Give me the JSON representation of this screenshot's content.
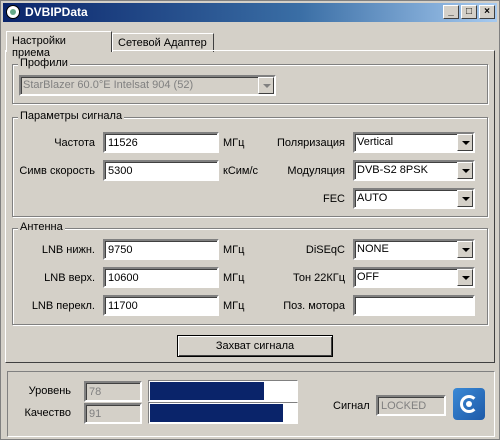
{
  "window": {
    "title": "DVBIPData",
    "min": "_",
    "max": "□",
    "close": "×"
  },
  "tabs": [
    {
      "label": "Настройки приема"
    },
    {
      "label": "Сетевой Адаптер"
    }
  ],
  "profiles": {
    "group_label": "Профили",
    "selected": "StarBlazer 60.0°E Intelsat 904 (52)"
  },
  "signal_params": {
    "group_label": "Параметры сигнала",
    "freq_label": "Частота",
    "freq_value": "11526",
    "freq_unit": "МГц",
    "sr_label": "Симв скорость",
    "sr_value": "5300",
    "sr_unit": "кСим/с",
    "pol_label": "Поляризация",
    "pol_value": "Vertical",
    "mod_label": "Модуляция",
    "mod_value": "DVB-S2 8PSK",
    "fec_label": "FEC",
    "fec_value": "AUTO"
  },
  "antenna": {
    "group_label": "Антенна",
    "lnb_low_label": "LNB нижн.",
    "lnb_low_value": "9750",
    "lnb_low_unit": "МГц",
    "lnb_high_label": "LNB верх.",
    "lnb_high_value": "10600",
    "lnb_high_unit": "МГц",
    "lnb_switch_label": "LNB перекл.",
    "lnb_switch_value": "11700",
    "lnb_switch_unit": "МГц",
    "diseqc_label": "DiSEqC",
    "diseqc_value": "NONE",
    "tone_label": "Тон 22КГц",
    "tone_value": "OFF",
    "motor_label": "Поз. мотора",
    "motor_value": ""
  },
  "capture_button": "Захват сигнала",
  "status": {
    "level_label": "Уровень",
    "level_value": "78",
    "level_fraction": 0.78,
    "quality_label": "Качество",
    "quality_value": "91",
    "quality_fraction": 0.91,
    "signal_label": "Сигнал",
    "signal_value": "LOCKED",
    "bar_color": "#0a246a"
  }
}
